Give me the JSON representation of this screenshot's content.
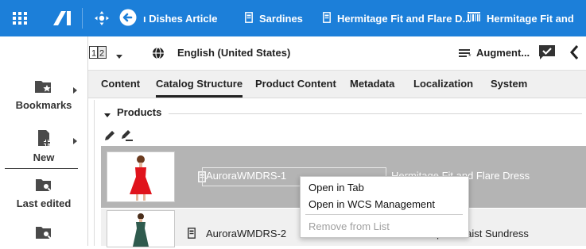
{
  "topbar": {
    "tabs": [
      {
        "label": "ı Dishes Article",
        "icon": "arrow-left-circle-icon"
      },
      {
        "label": "Sardines",
        "icon": "product-tag-icon"
      },
      {
        "label": "Hermitage Fit and Flare D...",
        "icon": "product-tag-icon"
      },
      {
        "label": "Hermitage Fit and",
        "icon": "barcode-icon"
      }
    ],
    "accent": "#1c7fd9"
  },
  "sidebar": {
    "items": [
      {
        "label": "Bookmarks",
        "icon": "bookmark-folder-icon"
      },
      {
        "label": "New",
        "icon": "new-document-icon"
      },
      {
        "label": "Last edited",
        "icon": "folder-search-icon"
      },
      {
        "label": "",
        "icon": "folder-search-icon"
      }
    ]
  },
  "toolbar": {
    "language": "English (United States)",
    "augment_label": "Augment..."
  },
  "tabs": [
    "Content",
    "Catalog Structure",
    "Product Content",
    "Metadata",
    "Localization",
    "System"
  ],
  "active_tab": "Catalog Structure",
  "section": {
    "title": "Products",
    "rows": [
      {
        "id": "AuroraWMDRS-1",
        "title": "Hermitage Fit and Flare Dress",
        "selected": true
      },
      {
        "id": "AuroraWMDRS-2",
        "title": "...rora Empire Waist Sundress",
        "selected": false
      }
    ]
  },
  "context_menu": {
    "items": [
      {
        "label": "Open in Tab",
        "enabled": true
      },
      {
        "label": "Open in WCS Management",
        "enabled": true
      },
      {
        "label": "Remove from List",
        "enabled": false
      }
    ]
  }
}
